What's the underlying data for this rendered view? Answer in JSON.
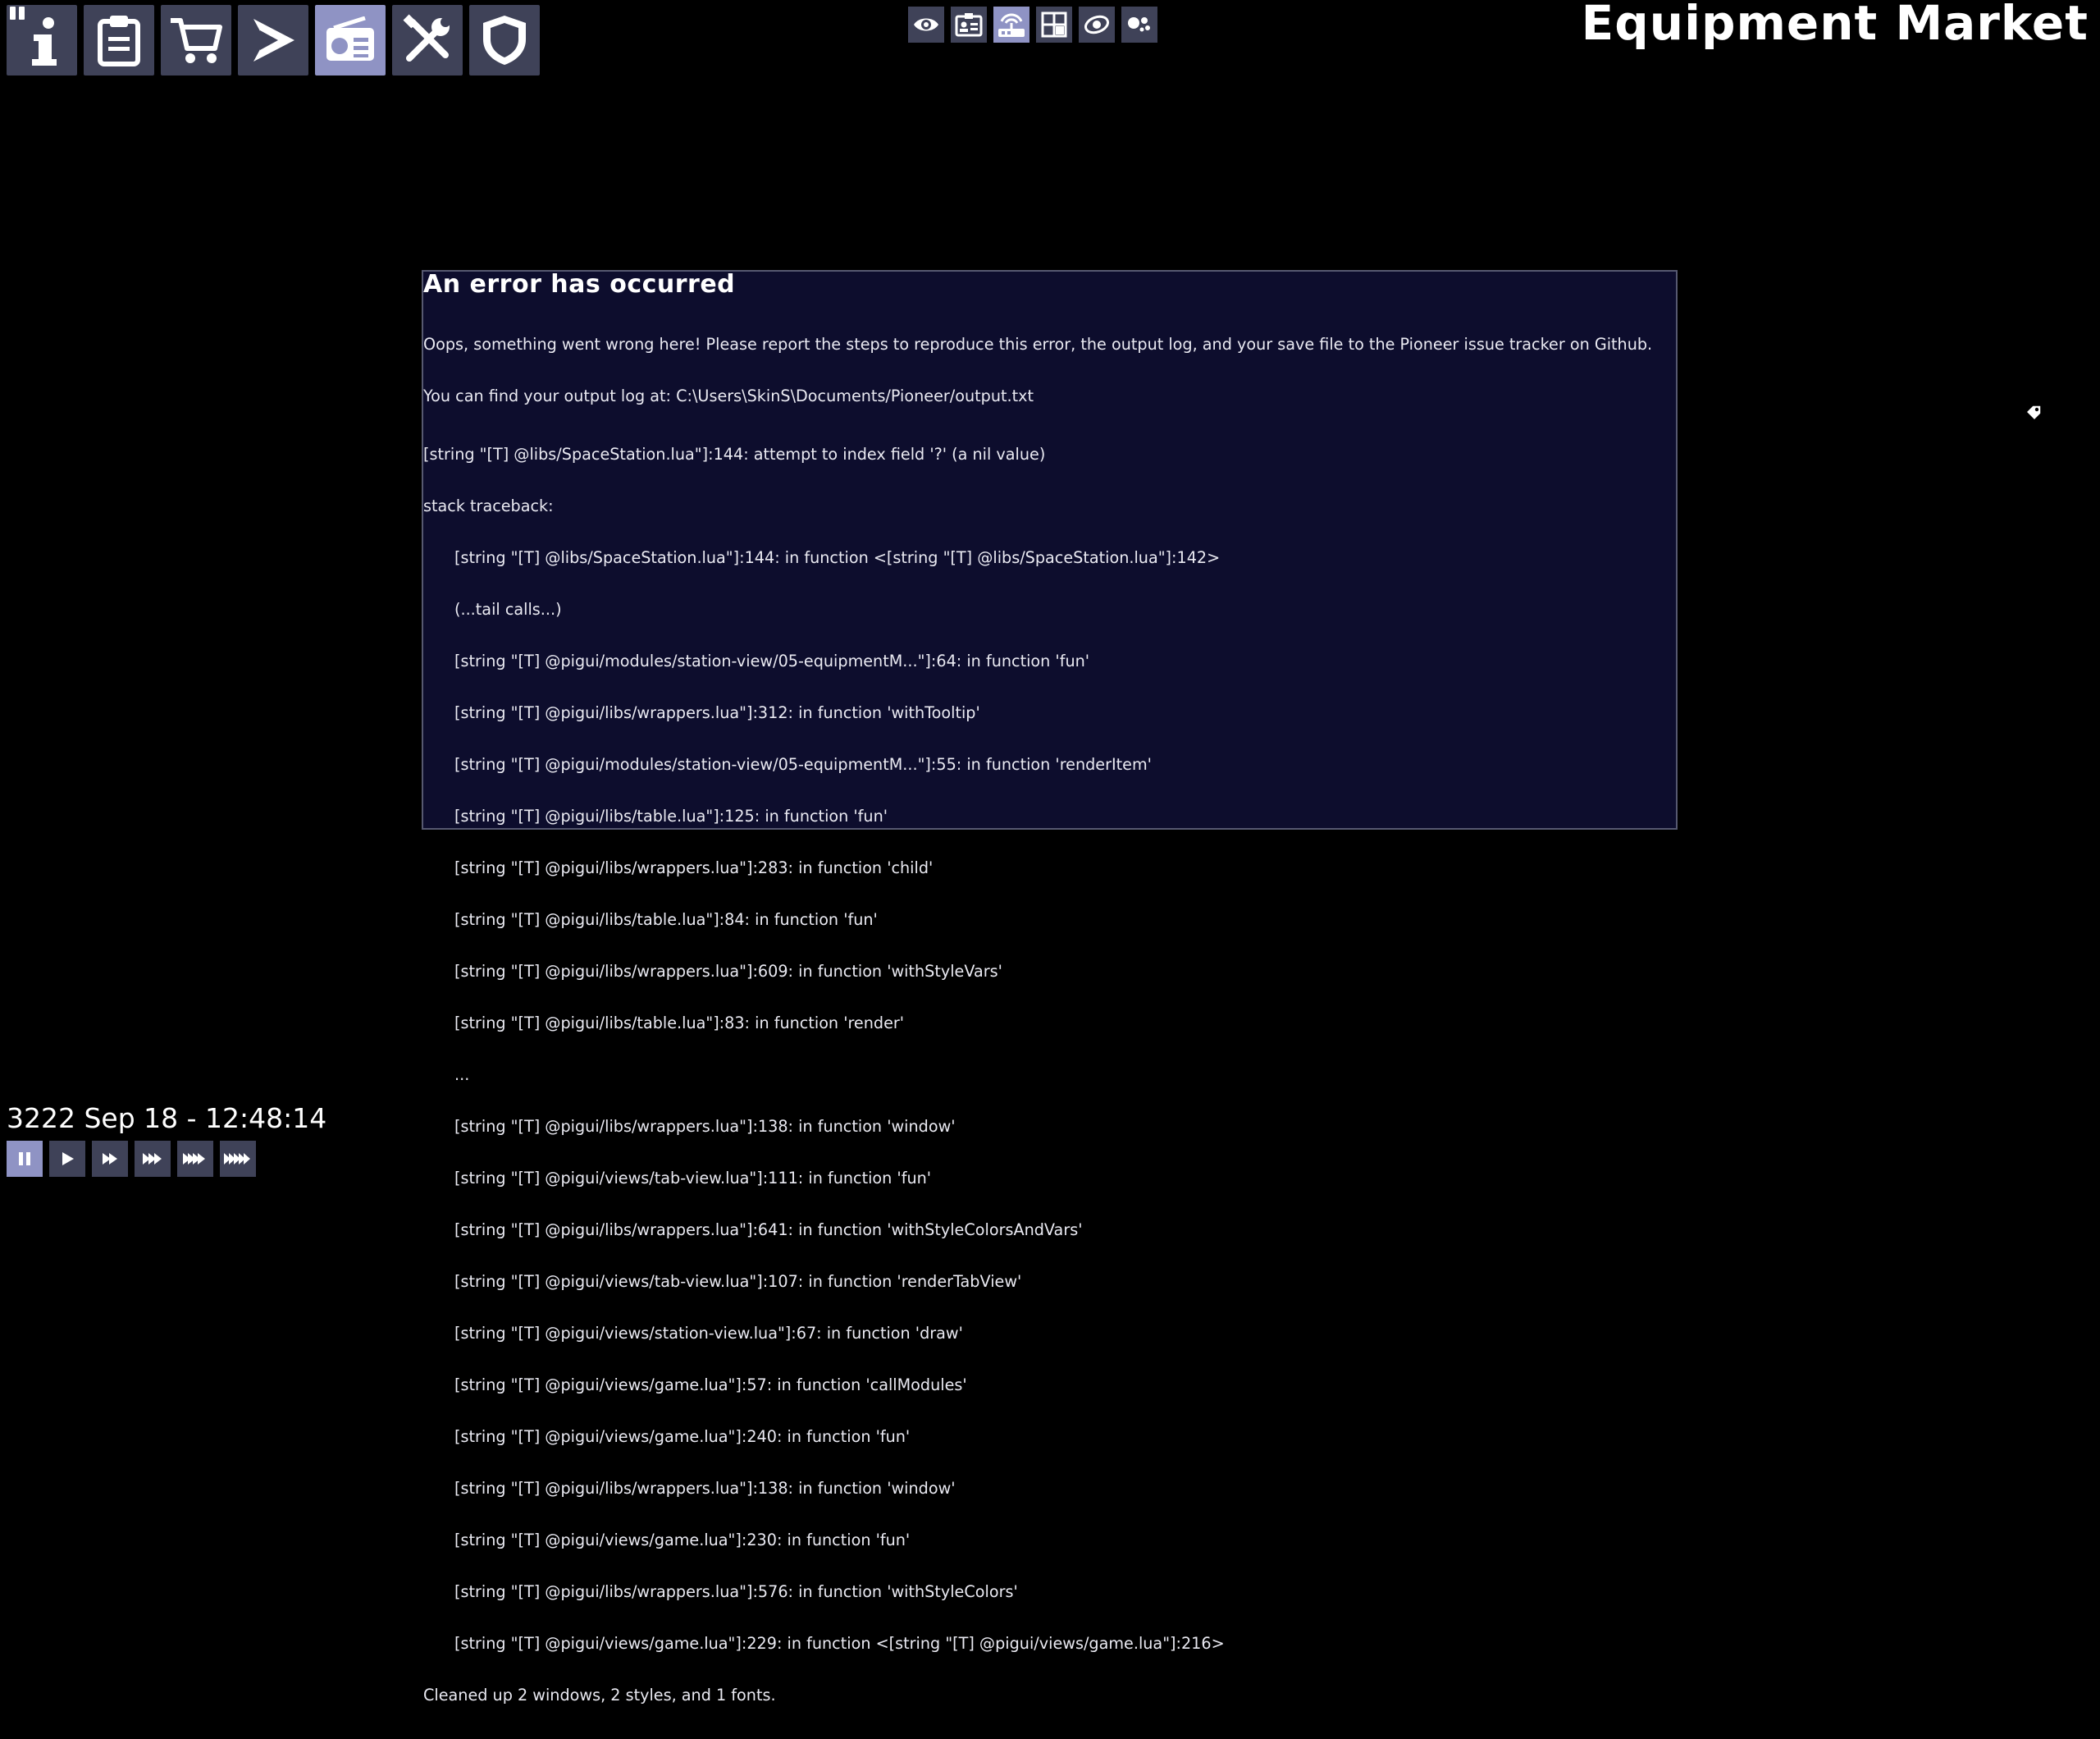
{
  "header": {
    "title": "Equipment Market"
  },
  "station_tabs": [
    {
      "name": "info-icon",
      "active": false
    },
    {
      "name": "clipboard-icon",
      "active": false
    },
    {
      "name": "cart-icon",
      "active": false
    },
    {
      "name": "ship-icon",
      "active": false
    },
    {
      "name": "radio-icon",
      "active": true
    },
    {
      "name": "tools-icon",
      "active": false
    },
    {
      "name": "shield-icon",
      "active": false
    }
  ],
  "view_buttons": [
    {
      "name": "eye-icon",
      "active": false
    },
    {
      "name": "id-card-icon",
      "active": false
    },
    {
      "name": "comms-icon",
      "active": true
    },
    {
      "name": "grid-map-icon",
      "active": false
    },
    {
      "name": "orbit-icon",
      "active": false
    },
    {
      "name": "people-icon",
      "active": false
    }
  ],
  "error": {
    "title": "An error has occurred",
    "message_1": "Oops, something went wrong here! Please report the steps to reproduce this error, the output log, and your save file to the Pioneer issue tracker on Github.",
    "message_2": "You can find your output log at: C:\\Users\\SkinS\\Documents/Pioneer/output.txt",
    "error_line": "[string \"[T] @libs/SpaceStation.lua\"]:144: attempt to index field '?' (a nil value)",
    "stack_header": "stack traceback:",
    "trace": [
      "[string \"[T] @libs/SpaceStation.lua\"]:144: in function <[string \"[T] @libs/SpaceStation.lua\"]:142>",
      "(...tail calls...)",
      "[string \"[T] @pigui/modules/station-view/05-equipmentM...\"]:64: in function 'fun'",
      "[string \"[T] @pigui/libs/wrappers.lua\"]:312: in function 'withTooltip'",
      "[string \"[T] @pigui/modules/station-view/05-equipmentM...\"]:55: in function 'renderItem'",
      "[string \"[T] @pigui/libs/table.lua\"]:125: in function 'fun'",
      "[string \"[T] @pigui/libs/wrappers.lua\"]:283: in function 'child'",
      "[string \"[T] @pigui/libs/table.lua\"]:84: in function 'fun'",
      "[string \"[T] @pigui/libs/wrappers.lua\"]:609: in function 'withStyleVars'",
      "[string \"[T] @pigui/libs/table.lua\"]:83: in function 'render'",
      "...",
      "[string \"[T] @pigui/libs/wrappers.lua\"]:138: in function 'window'",
      "[string \"[T] @pigui/views/tab-view.lua\"]:111: in function 'fun'",
      "[string \"[T] @pigui/libs/wrappers.lua\"]:641: in function 'withStyleColorsAndVars'",
      "[string \"[T] @pigui/views/tab-view.lua\"]:107: in function 'renderTabView'",
      "[string \"[T] @pigui/views/station-view.lua\"]:67: in function 'draw'",
      "[string \"[T] @pigui/views/game.lua\"]:57: in function 'callModules'",
      "[string \"[T] @pigui/views/game.lua\"]:240: in function 'fun'",
      "[string \"[T] @pigui/libs/wrappers.lua\"]:138: in function 'window'",
      "[string \"[T] @pigui/views/game.lua\"]:230: in function 'fun'",
      "[string \"[T] @pigui/libs/wrappers.lua\"]:576: in function 'withStyleColors'",
      "[string \"[T] @pigui/views/game.lua\"]:229: in function <[string \"[T] @pigui/views/game.lua\"]:216>"
    ],
    "cleanup": "Cleaned up 2 windows, 2 styles, and 1 fonts."
  },
  "status": {
    "date_time": "3222 Sep 18 - 12:48:14"
  },
  "time_controls": [
    {
      "name": "pause-icon",
      "active": true
    },
    {
      "name": "play-icon",
      "active": false
    },
    {
      "name": "fast-forward-1-icon",
      "active": false
    },
    {
      "name": "fast-forward-2-icon",
      "active": false
    },
    {
      "name": "fast-forward-3-icon",
      "active": false
    },
    {
      "name": "fast-forward-4-icon",
      "active": false
    }
  ],
  "colors": {
    "button_bg": "#3f4258",
    "button_active": "#8f93c4",
    "window_bg": "#0d0d2d",
    "window_border": "#565870"
  }
}
